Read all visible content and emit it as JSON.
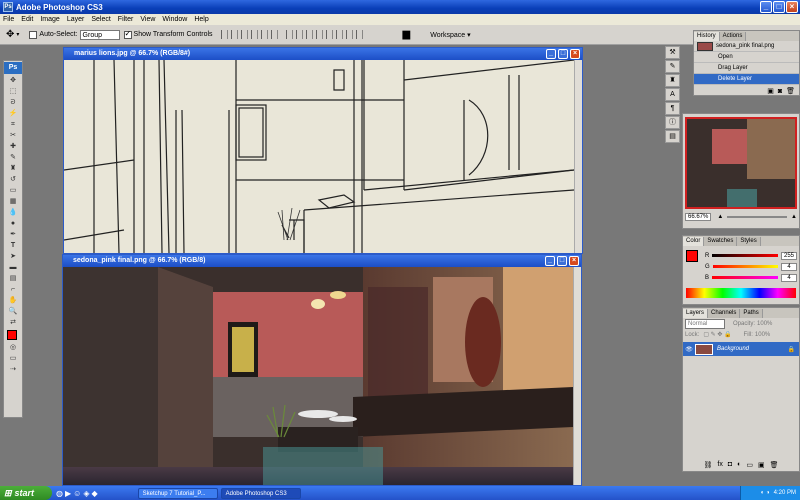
{
  "app": {
    "title": "Adobe Photoshop CS3",
    "logo": "Ps"
  },
  "menu": [
    "File",
    "Edit",
    "Image",
    "Layer",
    "Select",
    "Filter",
    "View",
    "Window",
    "Help"
  ],
  "options": {
    "auto_select_label": "Auto-Select:",
    "auto_select_value": "Group",
    "show_transform_label": "Show Transform Controls",
    "workspace_label": "Workspace"
  },
  "documents": [
    {
      "title": "marius lions.jpg @ 66.7% (RGB/8#)"
    },
    {
      "title": "sedona_pink final.png @ 66.7% (RGB/8)"
    }
  ],
  "history": {
    "tabs": [
      "History",
      "Actions"
    ],
    "snapshot": "sedona_pink final.png",
    "states": [
      "Open",
      "Drag Layer",
      "Delete Layer"
    ],
    "selected_index": 2
  },
  "navigator": {
    "zoom": "66.67%"
  },
  "color": {
    "tabs": [
      "Color",
      "Swatches",
      "Styles"
    ],
    "r": "255",
    "g": "4",
    "b": "4",
    "fg_color": "#ff0404"
  },
  "layers": {
    "tabs": [
      "Layers",
      "Channels",
      "Paths"
    ],
    "mode": "Normal",
    "opacity_label": "Opacity:",
    "opacity": "100%",
    "lock_label": "Lock:",
    "fill_label": "Fill:",
    "fill": "100%",
    "layer_name": "Background"
  },
  "taskbar": {
    "start": "start",
    "tasks": [
      "Sketchup 7 Tutorial_P...",
      "Adobe Photoshop CS3"
    ],
    "time": "4:20 PM"
  }
}
